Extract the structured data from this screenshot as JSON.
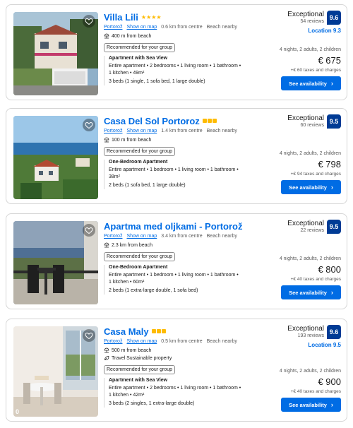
{
  "common": {
    "show_on_map": "Show on map",
    "recommended": "Recommended for your group",
    "nights": "4 nights, 2 adults, 2 children",
    "button": "See availability",
    "chevron": "›"
  },
  "properties": [
    {
      "name": "Villa Lili",
      "rating_type": "stars",
      "rating_count": 4,
      "town": "Portorož",
      "distance": "0.6 km from centre",
      "beach_tag": "Beach nearby",
      "beach_distance": "400 m from beach",
      "extra": "",
      "room_title": "Apartment with Sea View",
      "room_line1": "Entire apartment • 2 bedrooms • 1 living room • 1 bathroom •",
      "room_line2": "1 kitchen • 49m²",
      "beds": "3 beds (1 single, 1 sofa bed, 1 large double)",
      "score_label": "Exceptional",
      "reviews": "54 reviews",
      "score": "9.6",
      "location_score": "Location 9.3",
      "price": "€ 675",
      "taxes": "+€ 60 taxes and charges",
      "photo_counter": ""
    },
    {
      "name": "Casa Del Sol Portoroz",
      "rating_type": "squares",
      "rating_count": 3,
      "town": "Portorož",
      "distance": "1.4 km from centre",
      "beach_tag": "Beach nearby",
      "beach_distance": "100 m from beach",
      "extra": "",
      "room_title": "One-Bedroom Apartment",
      "room_line1": "Entire apartment • 1 bedroom • 1 living room • 1 bathroom •",
      "room_line2": "38m²",
      "beds": "2 beds (1 sofa bed, 1 large double)",
      "score_label": "Exceptional",
      "reviews": "60 reviews",
      "score": "9.5",
      "location_score": "",
      "price": "€ 798",
      "taxes": "+€ 94 taxes and charges",
      "photo_counter": ""
    },
    {
      "name": "Apartma med oljkami - Portorož",
      "rating_type": "none",
      "rating_count": 0,
      "town": "Portorož",
      "distance": "3.4 km from centre",
      "beach_tag": "Beach nearby",
      "beach_distance": "2.3 km from beach",
      "extra": "",
      "room_title": "One-Bedroom Apartment",
      "room_line1": "Entire apartment • 1 bedroom • 1 living room • 1 bathroom •",
      "room_line2": "1 kitchen • 60m²",
      "beds": "2 beds (1 extra-large double, 1 sofa bed)",
      "score_label": "Exceptional",
      "reviews": "22 reviews",
      "score": "9.5",
      "location_score": "",
      "price": "€ 800",
      "taxes": "+€ 40 taxes and charges",
      "photo_counter": ""
    },
    {
      "name": "Casa Maly",
      "rating_type": "squares",
      "rating_count": 3,
      "town": "Portorož",
      "distance": "0.5 km from centre",
      "beach_tag": "Beach nearby",
      "beach_distance": "500 m from beach",
      "extra": "Travel Sustainable property",
      "room_title": "Apartment with Sea View",
      "room_line1": "Entire apartment • 2 bedrooms • 1 living room • 1 bathroom •",
      "room_line2": "1 kitchen • 42m²",
      "beds": "3 beds (2 singles, 1 extra-large double)",
      "score_label": "Exceptional",
      "reviews": "193 reviews",
      "score": "9.6",
      "location_score": "Location 9.5",
      "price": "€ 900",
      "taxes": "+€ 40 taxes and charges",
      "photo_counter": "0"
    }
  ],
  "colors": {
    "brand_blue": "#006ce4",
    "score_blue": "#003b95",
    "star_yellow": "#febb02"
  }
}
